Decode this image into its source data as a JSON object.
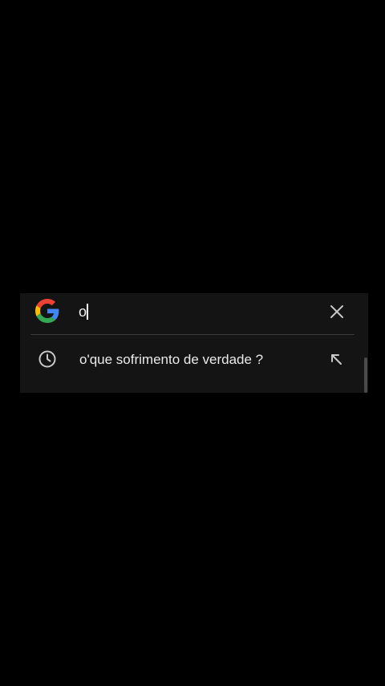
{
  "search": {
    "query": "o",
    "logo": "google-g-logo",
    "clear_icon": "close-icon"
  },
  "suggestions": [
    {
      "text": "o'que sofrimento de verdade ?",
      "leading_icon": "history-icon",
      "trailing_icon": "arrow-up-left-icon"
    }
  ],
  "colors": {
    "background": "#000000",
    "panel": "#141414",
    "text": "#eaeaea",
    "icon": "#c8c8c8",
    "google_blue": "#4285F4",
    "google_red": "#EA4335",
    "google_yellow": "#FBBC05",
    "google_green": "#34A853"
  }
}
